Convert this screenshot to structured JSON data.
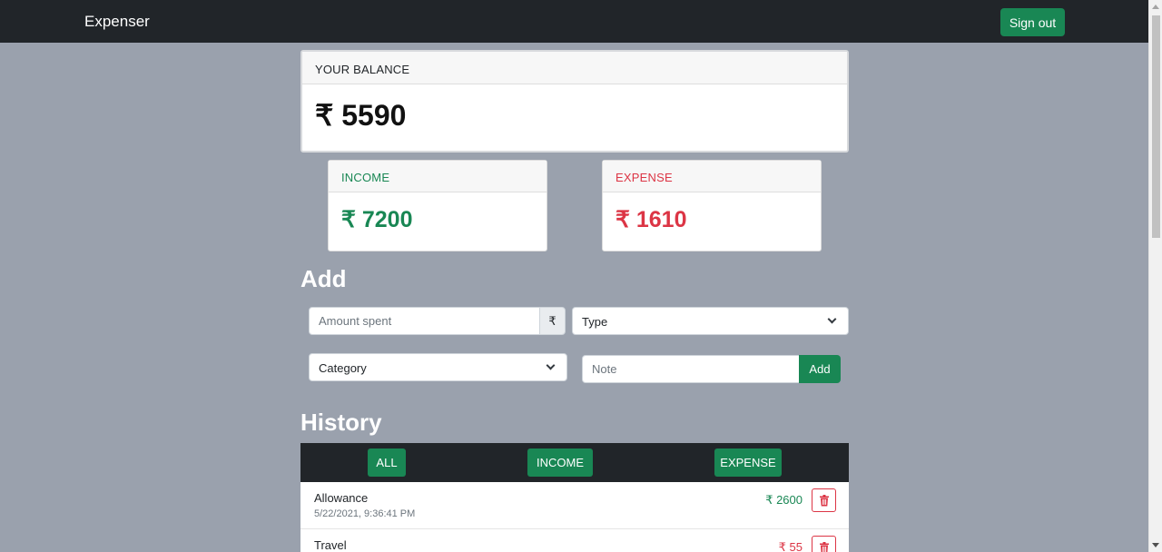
{
  "nav": {
    "brand": "Expenser",
    "signout_label": "Sign out"
  },
  "balance": {
    "label": "YOUR BALANCE",
    "value": "₹ 5590"
  },
  "income": {
    "label": "INCOME",
    "value": "₹ 7200"
  },
  "expense": {
    "label": "EXPENSE",
    "value": "₹ 1610"
  },
  "add": {
    "heading": "Add",
    "amount_placeholder": "Amount spent",
    "currency_addon": "₹",
    "type_value": "Type",
    "category_value": "Category",
    "note_placeholder": "Note",
    "add_label": "Add"
  },
  "history": {
    "heading": "History",
    "filters": [
      "ALL",
      "INCOME",
      "EXPENSE"
    ],
    "items": [
      {
        "name": "Allowance",
        "date": "5/22/2021, 9:36:41 PM",
        "amount": "₹ 2600",
        "kind": "income"
      },
      {
        "name": "Travel",
        "date": "",
        "amount": "₹ 55",
        "kind": "expense"
      }
    ]
  },
  "colors": {
    "success": "#198754",
    "danger": "#dc3545",
    "dark": "#212529",
    "page_bg": "#9aa1ad"
  }
}
